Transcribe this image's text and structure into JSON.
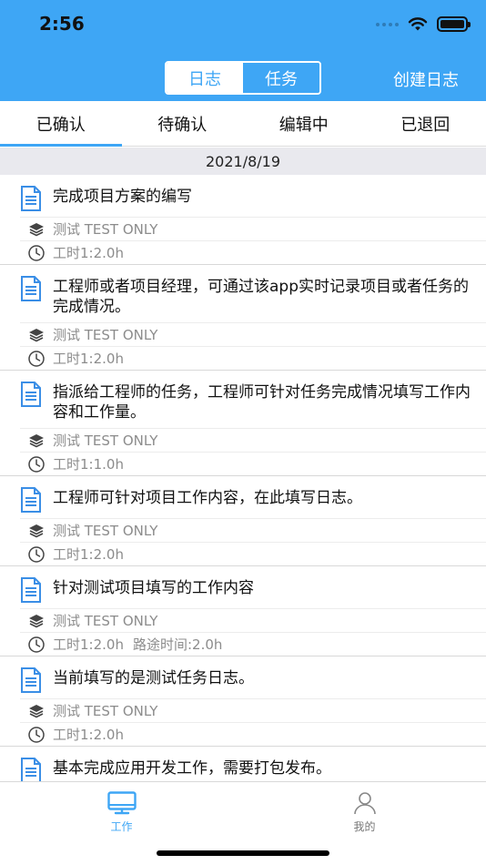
{
  "status_bar": {
    "time": "2:56"
  },
  "header": {
    "segments": [
      "日志",
      "任务"
    ],
    "active_segment": 0,
    "create_label": "创建日志",
    "accent": "#3ea6f5"
  },
  "tabs": [
    {
      "label": "已确认",
      "active": true
    },
    {
      "label": "待确认",
      "active": false
    },
    {
      "label": "编辑中",
      "active": false
    },
    {
      "label": "已退回",
      "active": false
    }
  ],
  "date_header": "2021/8/19",
  "entries": [
    {
      "title": "完成项目方案的编写",
      "project": "测试 TEST ONLY",
      "hours": "工时1:2.0h",
      "extra": ""
    },
    {
      "title": "工程师或者项目经理，可通过该app实时记录项目或者任务的完成情况。",
      "project": "测试 TEST ONLY",
      "hours": "工时1:2.0h",
      "extra": ""
    },
    {
      "title": "指派给工程师的任务，工程师可针对任务完成情况填写工作内容和工作量。",
      "project": "测试 TEST ONLY",
      "hours": "工时1:1.0h",
      "extra": ""
    },
    {
      "title": "工程师可针对项目工作内容，在此填写日志。",
      "project": "测试 TEST ONLY",
      "hours": "工时1:2.0h",
      "extra": ""
    },
    {
      "title": "针对测试项目填写的工作内容",
      "project": "测试 TEST ONLY",
      "hours": "工时1:2.0h",
      "extra": "路途时间:2.0h"
    },
    {
      "title": "当前填写的是测试任务日志。",
      "project": "测试 TEST ONLY",
      "hours": "工时1:2.0h",
      "extra": ""
    },
    {
      "title": "基本完成应用开发工作，需要打包发布。",
      "project": "",
      "hours": "",
      "extra": ""
    }
  ],
  "bottom_tabs": [
    {
      "label": "工作",
      "icon": "monitor-icon",
      "active": true
    },
    {
      "label": "我的",
      "icon": "person-icon",
      "active": false
    }
  ]
}
